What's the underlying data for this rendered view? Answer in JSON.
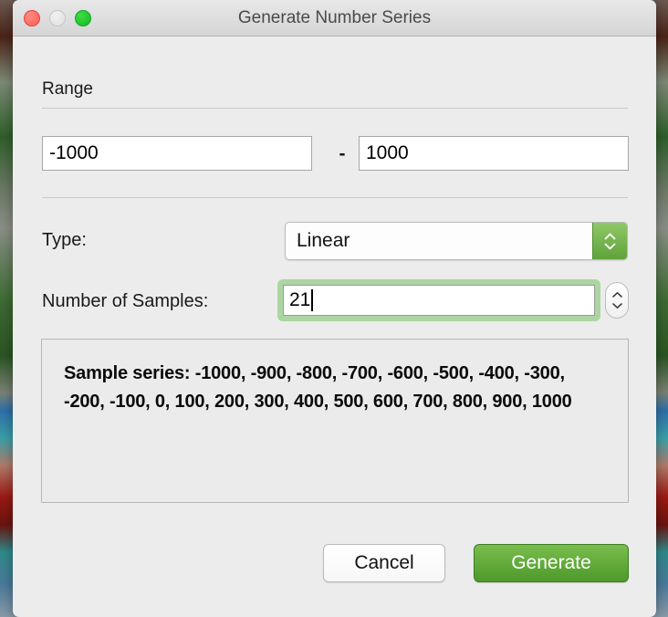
{
  "window": {
    "title": "Generate Number Series",
    "traffic_lights": [
      {
        "name": "close",
        "color": "#ff5f57"
      },
      {
        "name": "minimize",
        "color": "#dddddd"
      },
      {
        "name": "maximize",
        "color": "#0fbc1f"
      }
    ]
  },
  "range": {
    "group_label": "Range",
    "min_value": "-1000",
    "min_placeholder": "min",
    "separator": "-",
    "max_value": "1000",
    "max_placeholder": "max"
  },
  "type": {
    "label": "Type:",
    "selected": "Linear",
    "options": [
      "Linear"
    ],
    "stepper_icon": "chevron-up-down-icon",
    "accent_color": "#5fa23a"
  },
  "samples": {
    "label": "Number of Samples:",
    "value": "21",
    "placeholder": "",
    "focused": true,
    "focus_ring_color": "#abd6a3",
    "stepper_up_icon": "chevron-up-icon",
    "stepper_down_icon": "chevron-down-icon"
  },
  "preview": {
    "text": "Sample series: -1000, -900, -800, -700, -600, -500, -400, -300, -200, -100, 0, 100, 200, 300, 400, 500, 600, 700, 800, 900, 1000",
    "label_prefix": "Sample series:",
    "series": [
      -1000,
      -900,
      -800,
      -700,
      -600,
      -500,
      -400,
      -300,
      -200,
      -100,
      0,
      100,
      200,
      300,
      400,
      500,
      600,
      700,
      800,
      900,
      1000
    ]
  },
  "footer": {
    "cancel_label": "Cancel",
    "generate_label": "Generate",
    "generate_color": "#4e9a2a"
  }
}
